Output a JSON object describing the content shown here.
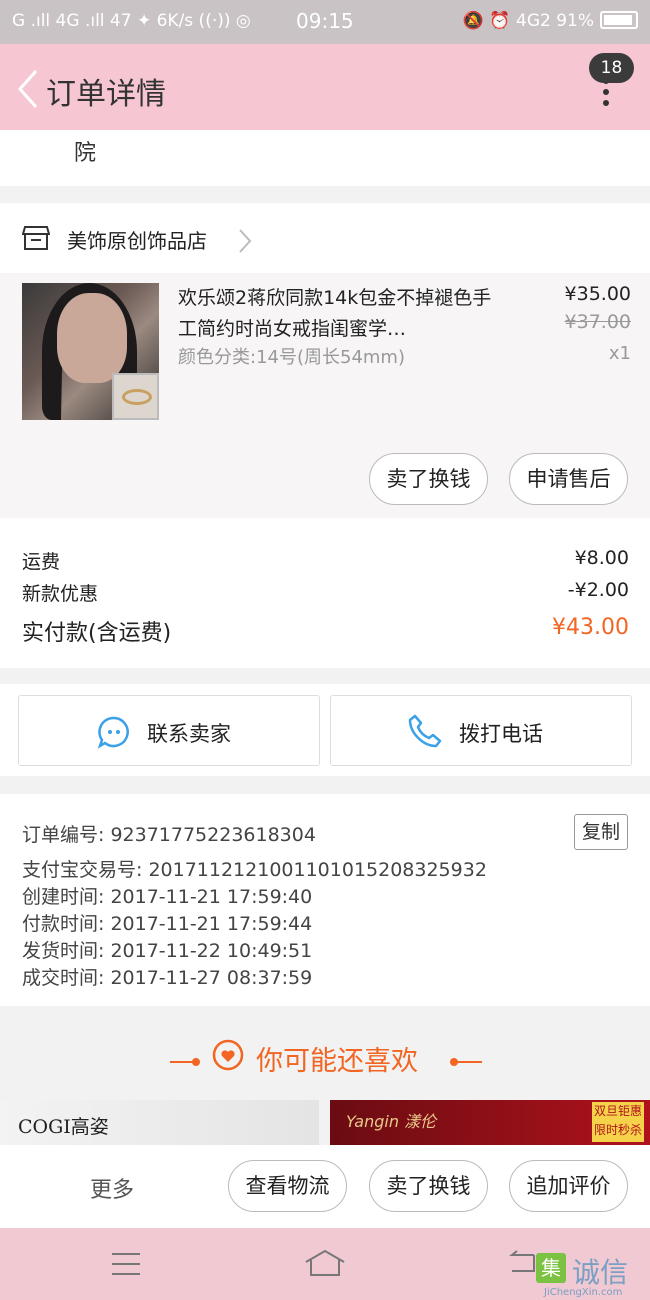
{
  "status_bar": {
    "left": "G .ıll 4G .ıll 47 ✦ 6K/s ((·)) ◎",
    "time": "09:15",
    "right": "🔕 ⏰ 4G2 91%",
    "battery_level": 0.91
  },
  "header": {
    "title": "订单详情",
    "badge": "18"
  },
  "address": {
    "tail": "院"
  },
  "store": {
    "name": "美饰原创饰品店"
  },
  "item": {
    "title": "欢乐颂2蒋欣同款14k包金不掉褪色手工简约时尚女戒指闺蜜学…",
    "variant": "颜色分类:14号(周长54mm)",
    "price": "¥35.00",
    "original_price": "¥37.00",
    "qty": "x1",
    "btn_exchange": "卖了换钱",
    "btn_aftersale": "申请售后"
  },
  "costs": {
    "shipping_label": "运费",
    "shipping_value": "¥8.00",
    "discount_label": "新款优惠",
    "discount_value": "-¥2.00",
    "paid_label": "实付款(含运费)",
    "paid_value": "¥43.00"
  },
  "actions": {
    "contact": "联系卖家",
    "call": "拨打电话"
  },
  "order_info": {
    "order_no": "订单编号: 92371775223618304",
    "copy": "复制",
    "alipay_no": "支付宝交易号: 2017112121001101015208325932",
    "created": "创建时间: 2017-11-21  17:59:40",
    "paid": "付款时间: 2017-11-21  17:59:44",
    "shipped": "发货时间: 2017-11-22  10:49:51",
    "completed": "成交时间: 2017-11-27  08:37:59"
  },
  "recommend": {
    "title": "你可能还喜欢",
    "banner1": "COGI高姿",
    "banner2": "Yangin 漾伦",
    "banner2_badge": "双旦钜惠 限时秒杀"
  },
  "bottom_bar": {
    "more": "更多",
    "logistics": "查看物流",
    "exchange": "卖了换钱",
    "review": "追加评价"
  },
  "watermark": {
    "cn": "诚信",
    "en": "JiChengXin.com",
    "box": "集"
  },
  "colors": {
    "header_bg": "#f6c7d3",
    "accent": "#f26522",
    "nav_bg": "#f0c9d2"
  }
}
